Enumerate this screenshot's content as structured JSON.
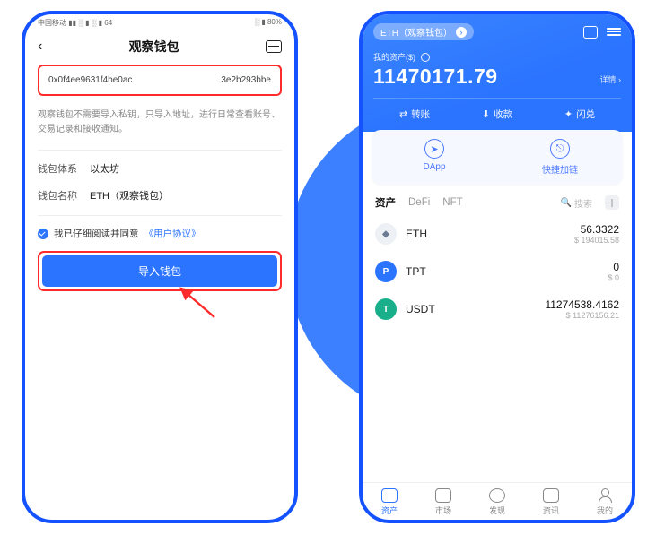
{
  "left": {
    "status": {
      "l": "中国移动 ▮▮ ░ ▮ ░ ▮ 64",
      "r": "░ ▮ 80%"
    },
    "title": "观察钱包",
    "addr_a": "0x0f4ee9631f4be0ac",
    "addr_b": "3e2b293bbe",
    "desc": "观察钱包不需要导入私钥，只导入地址，进行日常查看账号、交易记录和接收通知。",
    "chain_label": "钱包体系",
    "chain_value": "以太坊",
    "name_label": "钱包名称",
    "name_value": "ETH（观察钱包）",
    "agree_text": "我已仔细阅读并同意",
    "agree_link": "《用户协议》",
    "import_btn": "导入钱包"
  },
  "right": {
    "pill": "ETH（观察钱包）",
    "asset_label": "我的资产($)",
    "amount": "11470171.79",
    "detail": "详情 ›",
    "actions": {
      "transfer": "转账",
      "receive": "收款",
      "swap": "闪兑"
    },
    "mid": {
      "dapp": "DApp",
      "quick": "快捷加链"
    },
    "tabs": {
      "assets": "资产",
      "defi": "DeFi",
      "nft": "NFT",
      "search": "搜索"
    },
    "list": [
      {
        "sym": "ETH",
        "amt": "56.3322",
        "fiat": "$ 194015.58"
      },
      {
        "sym": "TPT",
        "amt": "0",
        "fiat": "$ 0"
      },
      {
        "sym": "USDT",
        "amt": "11274538.4162",
        "fiat": "$ 11276156.21"
      }
    ],
    "nav": {
      "assets": "资产",
      "market": "市场",
      "discover": "发现",
      "news": "资讯",
      "me": "我的"
    }
  }
}
